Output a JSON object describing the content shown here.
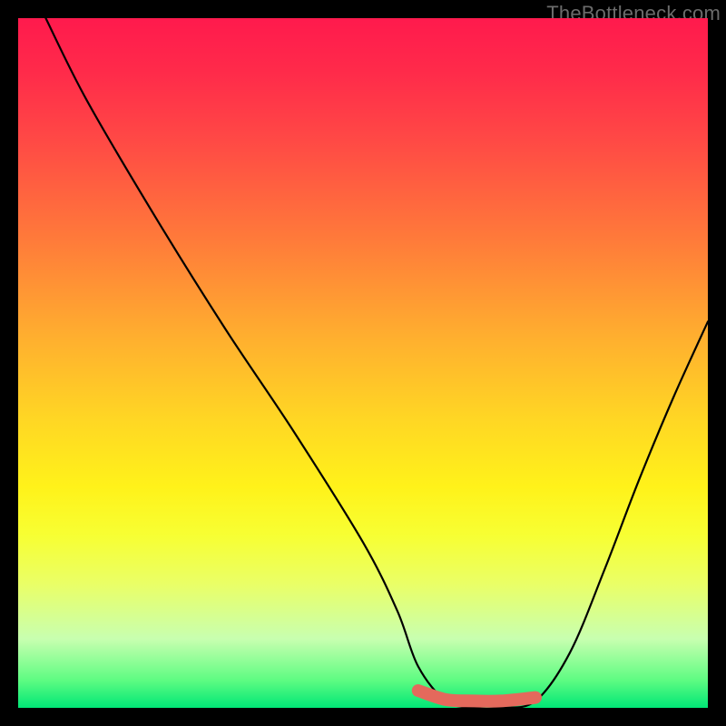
{
  "attribution": "TheBottleneck.com",
  "chart_data": {
    "type": "line",
    "title": "",
    "xlabel": "",
    "ylabel": "",
    "xlim": [
      0,
      100
    ],
    "ylim": [
      0,
      100
    ],
    "annotations": [],
    "series": [
      {
        "name": "bottleneck-curve",
        "color": "#000000",
        "x": [
          4,
          10,
          20,
          30,
          40,
          50,
          55,
          58,
          62,
          66,
          70,
          75,
          80,
          85,
          90,
          95,
          100
        ],
        "y": [
          100,
          88,
          71,
          55,
          40,
          24,
          14,
          6,
          1,
          0,
          0,
          1,
          8,
          20,
          33,
          45,
          56
        ]
      },
      {
        "name": "optimal-zone-highlight",
        "color": "#e4695c",
        "x": [
          58,
          62,
          66,
          70,
          75
        ],
        "y": [
          2.5,
          1.2,
          1.0,
          1.0,
          1.5
        ]
      }
    ],
    "background_gradient": {
      "top": "#ff1a4d",
      "mid": "#ffd624",
      "bottom": "#00e676"
    }
  }
}
